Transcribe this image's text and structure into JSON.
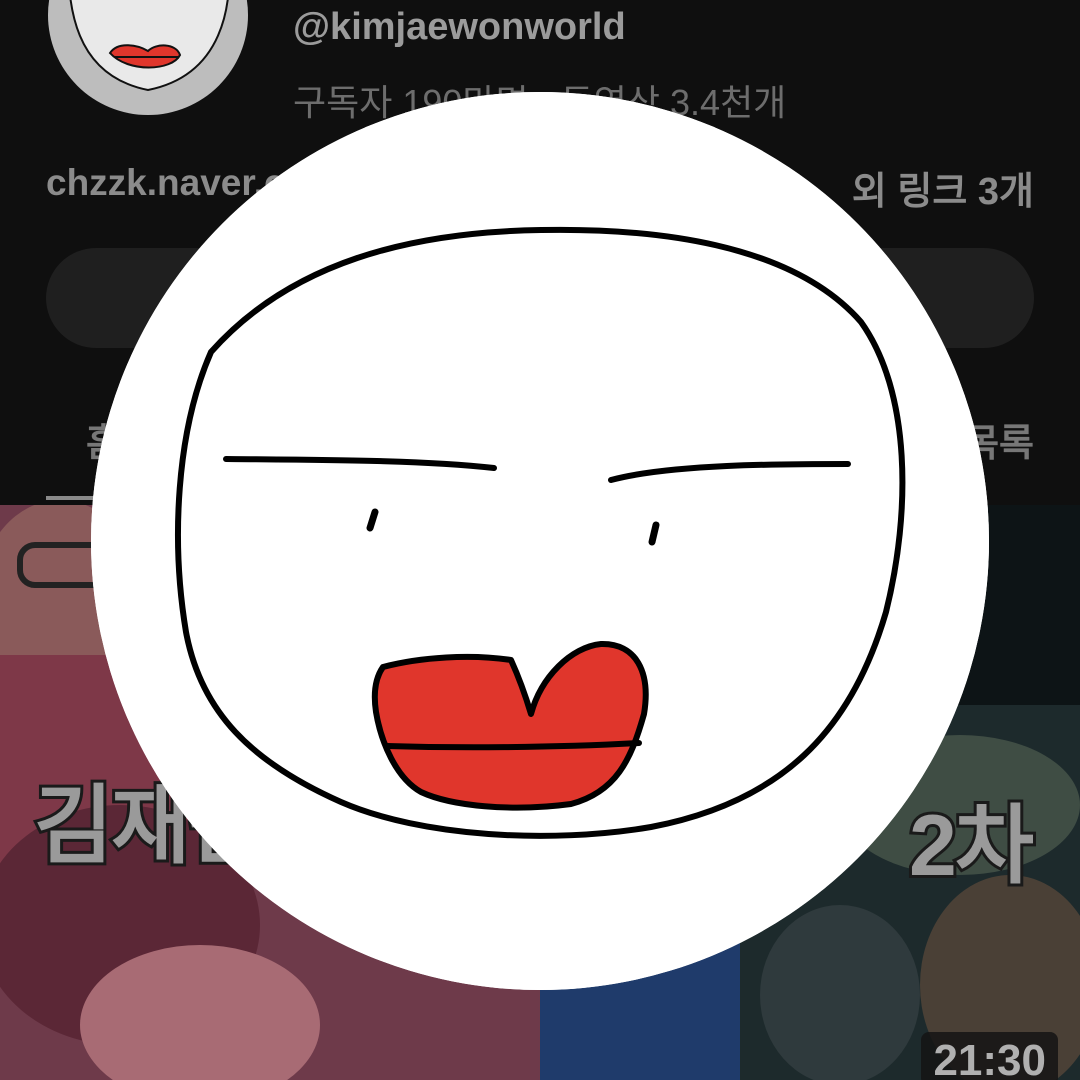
{
  "channel": {
    "handle": "@kimjaewonworld",
    "stats": "구독자 190만명 · 동영상 3.4천개",
    "link": "chzzk.naver.com",
    "links_more": "외 링크 3개"
  },
  "tabs": [
    {
      "label": "홈"
    },
    {
      "label": "재생목록"
    }
  ],
  "videos": [
    {
      "overlay_text": "김재원"
    },
    {
      "overlay_text": "2차",
      "duration": "21:30"
    }
  ],
  "colors": {
    "background": "#0f0f0f",
    "avatar_bg": "#ffffff",
    "lips": "#e0362c",
    "outline": "#000000"
  },
  "icons": {
    "profile_picture": "hand-drawn-face-with-red-lips"
  }
}
